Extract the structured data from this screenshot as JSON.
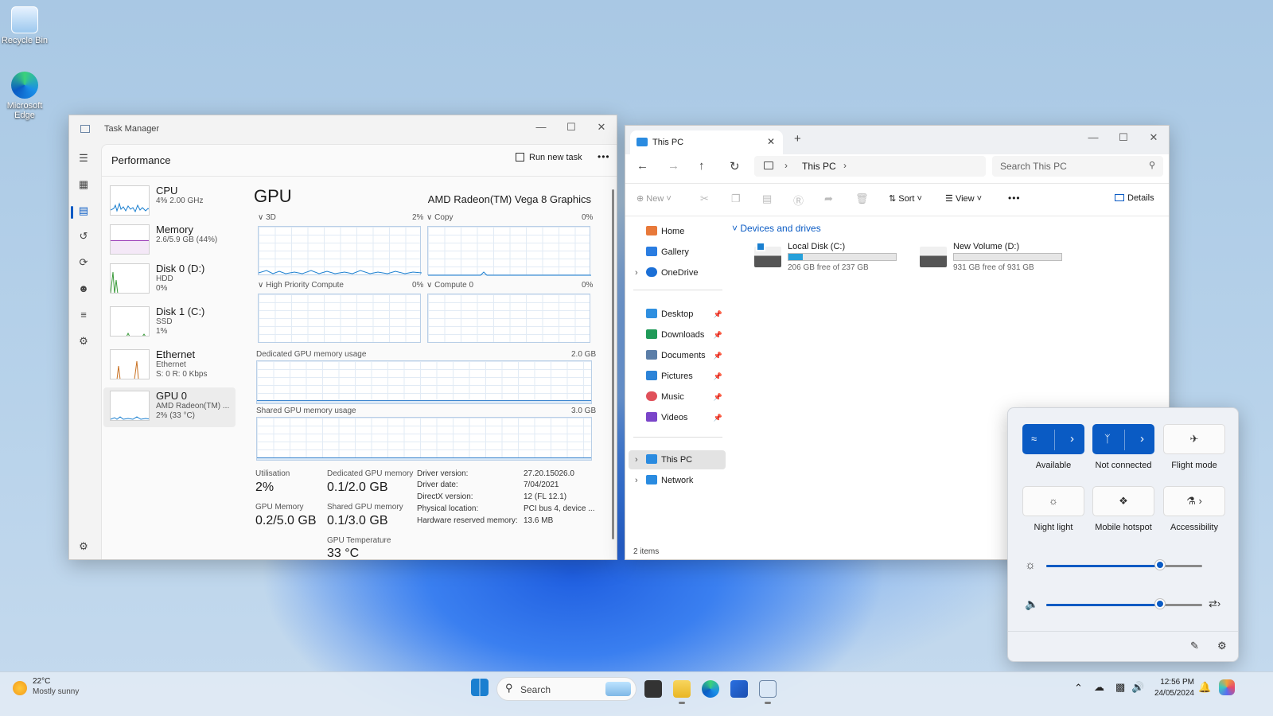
{
  "desktop": {
    "icons": [
      {
        "label": "Recycle Bin"
      },
      {
        "label": "Microsoft Edge"
      }
    ]
  },
  "task_manager": {
    "title": "Task Manager",
    "section": "Performance",
    "run_new_task": "Run new task",
    "more": "•••",
    "items": [
      {
        "name": "CPU",
        "l2": "4% 2.00 GHz",
        "l3": ""
      },
      {
        "name": "Memory",
        "l2": "2.6/5.9 GB (44%)",
        "l3": ""
      },
      {
        "name": "Disk 0 (D:)",
        "l2": "HDD",
        "l3": "0%"
      },
      {
        "name": "Disk 1 (C:)",
        "l2": "SSD",
        "l3": "1%"
      },
      {
        "name": "Ethernet",
        "l2": "Ethernet",
        "l3": "S: 0 R: 0 Kbps"
      },
      {
        "name": "GPU 0",
        "l2": "AMD Radeon(TM) ...",
        "l3": "2% (33 °C)"
      }
    ],
    "gpu": {
      "heading": "GPU",
      "model": "AMD Radeon(TM) Vega 8 Graphics",
      "engines": [
        {
          "name": "3D",
          "pct": "2%"
        },
        {
          "name": "Copy",
          "pct": "0%"
        },
        {
          "name": "High Priority Compute",
          "pct": "0%"
        },
        {
          "name": "Compute 0",
          "pct": "0%"
        }
      ],
      "dedicated_label": "Dedicated GPU memory usage",
      "dedicated_max": "2.0 GB",
      "shared_label": "Shared GPU memory usage",
      "shared_max": "3.0 GB",
      "stats": {
        "utilisation_l": "Utilisation",
        "utilisation_v": "2%",
        "gpu_memory_l": "GPU Memory",
        "gpu_memory_v": "0.2/5.0 GB",
        "dedicated_l": "Dedicated GPU memory",
        "dedicated_v": "0.1/2.0 GB",
        "shared_l": "Shared GPU memory",
        "shared_v": "0.1/3.0 GB",
        "temp_l": "GPU Temperature",
        "temp_v": "33 °C"
      },
      "details": [
        {
          "k": "Driver version:",
          "v": "27.20.15026.0"
        },
        {
          "k": "Driver date:",
          "v": "7/04/2021"
        },
        {
          "k": "DirectX version:",
          "v": "12 (FL 12.1)"
        },
        {
          "k": "Physical location:",
          "v": "PCI bus 4, device ..."
        },
        {
          "k": "Hardware reserved memory:",
          "v": "13.6 MB"
        }
      ]
    }
  },
  "explorer": {
    "tab_title": "This PC",
    "new_tab": "+",
    "breadcrumb": "This PC",
    "search_placeholder": "Search This PC",
    "toolbar": {
      "new": "New",
      "sort": "Sort",
      "view": "View",
      "more": "•••",
      "details": "Details"
    },
    "nav": [
      {
        "label": "Home",
        "color": "#e8793a"
      },
      {
        "label": "Gallery",
        "color": "#2a7de1"
      },
      {
        "label": "OneDrive",
        "color": "#1b6fd6"
      },
      {
        "label": "Desktop",
        "color": "#2f8fe0"
      },
      {
        "label": "Downloads",
        "color": "#1f9a58"
      },
      {
        "label": "Documents",
        "color": "#5b7ea8"
      },
      {
        "label": "Pictures",
        "color": "#2b83d8"
      },
      {
        "label": "Music",
        "color": "#e0505a"
      },
      {
        "label": "Videos",
        "color": "#7a45c9"
      },
      {
        "label": "This PC",
        "color": "#2a8be0"
      },
      {
        "label": "Network",
        "color": "#2a8be0"
      }
    ],
    "group": "Devices and drives",
    "drives": [
      {
        "name": "Local Disk (C:)",
        "free": "206 GB free of 237 GB",
        "used_fraction": 0.13
      },
      {
        "name": "New Volume (D:)",
        "free": "931 GB free of 931 GB",
        "used_fraction": 0.0
      }
    ],
    "status": "2 items"
  },
  "quick_settings": {
    "tiles": [
      {
        "label": "Available",
        "icon": "wifi-icon"
      },
      {
        "label": "Not connected",
        "icon": "bluetooth-icon"
      },
      {
        "label": "Flight mode",
        "icon": "airplane-icon"
      },
      {
        "label": "Night light",
        "icon": "night-light-icon"
      },
      {
        "label": "Mobile hotspot",
        "icon": "hotspot-icon"
      },
      {
        "label": "Accessibility",
        "icon": "accessibility-icon"
      }
    ],
    "brightness": 0.73,
    "volume": 0.73,
    "accent": "#0a5bc4"
  },
  "taskbar": {
    "weather_temp": "22°C",
    "weather_desc": "Mostly sunny",
    "search": "Search",
    "time": "12:56 PM",
    "date": "24/05/2024"
  }
}
